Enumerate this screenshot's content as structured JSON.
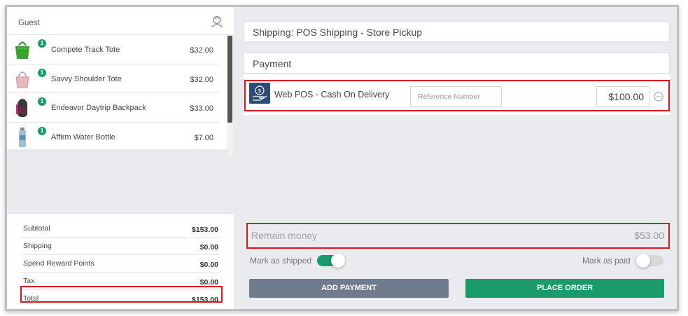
{
  "customer": {
    "label": "Guest",
    "icon": "customer-icon"
  },
  "cart": {
    "items": [
      {
        "name": "Compete Track Tote",
        "price": "$32.00",
        "qty": "1",
        "image": "green-tote-bag",
        "color": "#3aa32e"
      },
      {
        "name": "Savvy Shoulder Tote",
        "price": "$32.00",
        "qty": "1",
        "image": "pink-shoulder-tote",
        "color": "#e8b9c0"
      },
      {
        "name": "Endeavor Daytrip Backpack",
        "price": "$33.00",
        "qty": "1",
        "image": "dark-backpack",
        "color": "#3a3a3a"
      },
      {
        "name": "Affirm Water Bottle",
        "price": "$7.00",
        "qty": "1",
        "image": "water-bottle",
        "color": "#9cc0d6"
      }
    ]
  },
  "totals": [
    {
      "label": "Subtotal",
      "value": "$153.00"
    },
    {
      "label": "Shipping",
      "value": "$0.00"
    },
    {
      "label": "Spend Reward Points",
      "value": "$0.00"
    },
    {
      "label": "Tax",
      "value": "$0.00"
    },
    {
      "label": "Total",
      "value": "$153.00"
    }
  ],
  "shipping": {
    "text": "Shipping: POS Shipping - Store Pickup"
  },
  "payment": {
    "title": "Payment",
    "method": {
      "name": "Web POS - Cash On Delivery",
      "icon": "cash-on-delivery-icon",
      "reference_placeholder": "Reference Number",
      "reference_value": "",
      "amount": "$100.00"
    }
  },
  "remain": {
    "label": "Remain money",
    "value": "$53.00"
  },
  "toggles": {
    "shipped": {
      "label": "Mark as shipped",
      "on": true
    },
    "paid": {
      "label": "Mark as paid",
      "on": false
    }
  },
  "buttons": {
    "add_payment": "ADD PAYMENT",
    "place_order": "PLACE ORDER"
  },
  "colors": {
    "accent": "#1b9a6c",
    "highlight": "#e0141e",
    "secondary_button": "#707c8e",
    "method_icon_bg": "#2d4b79"
  }
}
